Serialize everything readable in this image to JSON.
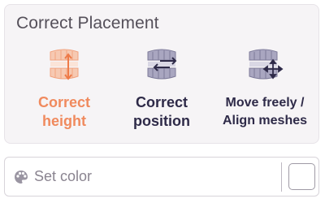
{
  "panel": {
    "title": "Correct Placement",
    "options": [
      {
        "line1": "Correct",
        "line2": "height",
        "icon": "teeth-height-icon",
        "active": true
      },
      {
        "line1": "Correct",
        "line2": "position",
        "icon": "teeth-position-icon",
        "active": false
      },
      {
        "line1": "Move freely /",
        "line2": "Align meshes",
        "icon": "teeth-move-icon",
        "active": false
      }
    ]
  },
  "color": {
    "label": "Set color",
    "icon": "palette-icon",
    "swatch": "#ffffff"
  },
  "colors": {
    "accent": "#f08a5e",
    "dark": "#2e2a48",
    "icon_gray": "#8e8aa6"
  }
}
